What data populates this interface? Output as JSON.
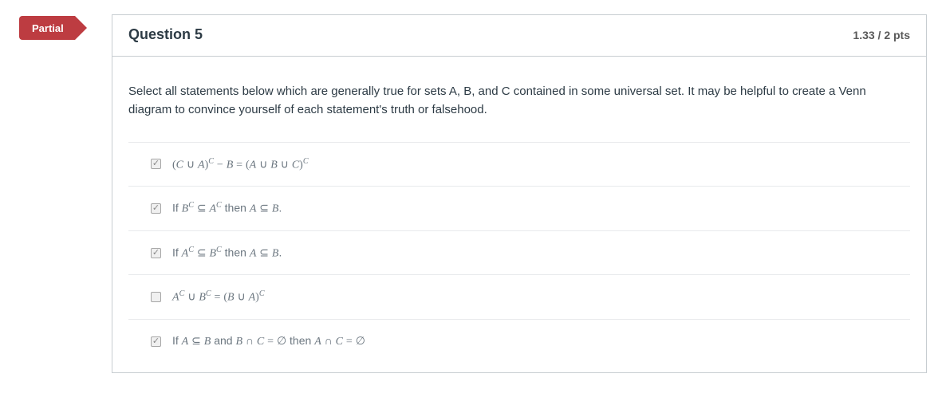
{
  "badge": "Partial",
  "header": {
    "title": "Question 5",
    "points": "1.33 / 2 pts"
  },
  "prompt": "Select all statements below which are generally true for sets A, B, and C contained in some universal set. It may be helpful to create a Venn diagram to convince yourself of each statement's truth or falsehood.",
  "answers": [
    {
      "checked": true,
      "html": "<span class='mo'>(</span><span class='mi'>C</span> <span class='mo'>∪</span> <span class='mi'>A</span><span class='mo'>)</span><span class='sup'>C</span> <span class='mo'>−</span> <span class='mi'>B</span> <span class='mo'>=</span> <span class='mo'>(</span><span class='mi'>A</span> <span class='mo'>∪</span> <span class='mi'>B</span> <span class='mo'>∪</span> <span class='mi'>C</span><span class='mo'>)</span><span class='sup'>C</span>"
    },
    {
      "checked": true,
      "html": "<span class='txt'>If </span><span class='mi'>B</span><span class='sup'>C</span> <span class='mo'>⊆</span> <span class='mi'>A</span><span class='sup'>C</span><span class='txt'> then </span><span class='mi'>A</span> <span class='mo'>⊆</span> <span class='mi'>B</span><span class='txt'>.</span>"
    },
    {
      "checked": true,
      "html": "<span class='txt'>If </span><span class='mi'>A</span><span class='sup'>C</span> <span class='mo'>⊆</span> <span class='mi'>B</span><span class='sup'>C</span><span class='txt'> then </span><span class='mi'>A</span> <span class='mo'>⊆</span> <span class='mi'>B</span><span class='txt'>.</span>"
    },
    {
      "checked": false,
      "html": "<span class='mi'>A</span><span class='sup'>C</span> <span class='mo'>∪</span> <span class='mi'>B</span><span class='sup'>C</span> <span class='mo'>=</span> <span class='mo'>(</span><span class='mi'>B</span> <span class='mo'>∪</span> <span class='mi'>A</span><span class='mo'>)</span><span class='sup'>C</span>"
    },
    {
      "checked": true,
      "html": "<span class='txt'>If </span><span class='mi'>A</span> <span class='mo'>⊆</span> <span class='mi'>B</span><span class='txt'> and </span><span class='mi'>B</span> <span class='mo'>∩</span> <span class='mi'>C</span> <span class='mo'>=</span> <span class='empty'>∅</span><span class='txt'> then </span><span class='mi'>A</span> <span class='mo'>∩</span> <span class='mi'>C</span> <span class='mo'>=</span> <span class='empty'>∅</span>"
    }
  ]
}
